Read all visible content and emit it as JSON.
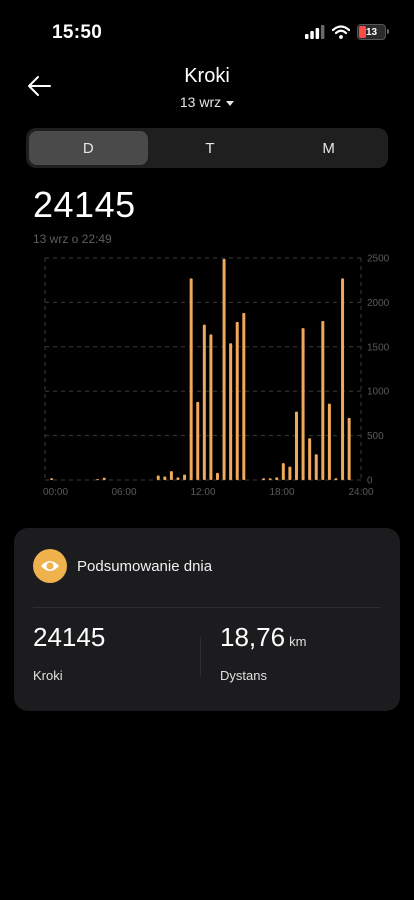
{
  "status": {
    "time": "15:50",
    "battery": "13",
    "battery_color": "#ff4a4a"
  },
  "header": {
    "title": "Kroki",
    "date": "13 wrz"
  },
  "tabs": [
    {
      "label": "D",
      "active": true
    },
    {
      "label": "T",
      "active": false
    },
    {
      "label": "M",
      "active": false
    }
  ],
  "summary": {
    "total_steps": "24145",
    "updated": "13 wrz o 22:49"
  },
  "chart_data": {
    "type": "bar",
    "x_ticks": [
      "00:00",
      "06:00",
      "12:00",
      "18:00",
      "24:00"
    ],
    "y_ticks": [
      "0",
      "500",
      "1000",
      "1500",
      "2000",
      "2500"
    ],
    "ylim": [
      0,
      2500
    ],
    "xlim_hours": [
      0,
      24
    ],
    "bar_color": "#f0a95b",
    "x_hours": [
      0.5,
      4.0,
      4.5,
      8.6,
      9.1,
      9.6,
      10.1,
      10.6,
      11.1,
      11.6,
      12.1,
      12.6,
      13.1,
      13.6,
      14.1,
      14.6,
      15.1,
      16.6,
      17.1,
      17.6,
      18.1,
      18.6,
      19.1,
      19.6,
      20.1,
      20.6,
      21.1,
      21.6,
      22.1,
      22.6,
      23.1
    ],
    "values": [
      20,
      10,
      25,
      50,
      40,
      100,
      30,
      60,
      2270,
      880,
      1750,
      1640,
      80,
      2490,
      1540,
      1780,
      1880,
      20,
      20,
      30,
      190,
      150,
      770,
      1710,
      470,
      290,
      1790,
      860,
      20,
      2270,
      700
    ]
  },
  "day_summary": {
    "title": "Podsumowanie dnia",
    "icon": "eye-icon",
    "icon_color": "#f0b24d",
    "steps_value": "24145",
    "steps_label": "Kroki",
    "distance_value": "18,76",
    "distance_unit": "km",
    "distance_label": "Dystans"
  }
}
